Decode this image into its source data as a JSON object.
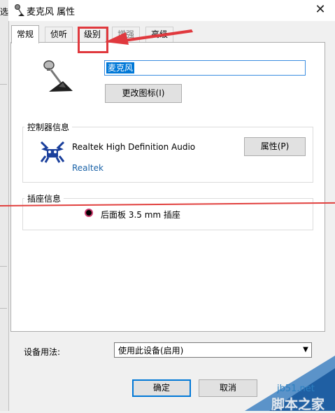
{
  "background": {
    "glyph": "选"
  },
  "dialog": {
    "title": "麦克风 属性",
    "close_glyph": "✕",
    "tabs": [
      {
        "label": "常规",
        "active": true
      },
      {
        "label": "侦听",
        "active": false
      },
      {
        "label": "级别",
        "active": false,
        "highlighted": true
      },
      {
        "label": "增强",
        "active": false
      },
      {
        "label": "高级",
        "active": false
      }
    ],
    "device_name": "麦克风",
    "change_icon_button": "更改图标(I)",
    "controller": {
      "group_label": "控制器信息",
      "name": "Realtek High Definition Audio",
      "vendor": "Realtek",
      "properties_button": "属性(P)"
    },
    "jack": {
      "group_label": "插座信息",
      "text": "后面板 3.5 mm 插座"
    },
    "usage": {
      "label": "设备用法:",
      "selected": "使用此设备(启用)"
    },
    "buttons": {
      "ok": "确定",
      "cancel": "取消"
    }
  },
  "watermark": {
    "site": "jb51.net",
    "name": "脚本之家"
  },
  "colors": {
    "highlight_red": "#e0393e",
    "accent_blue": "#0078d7"
  }
}
